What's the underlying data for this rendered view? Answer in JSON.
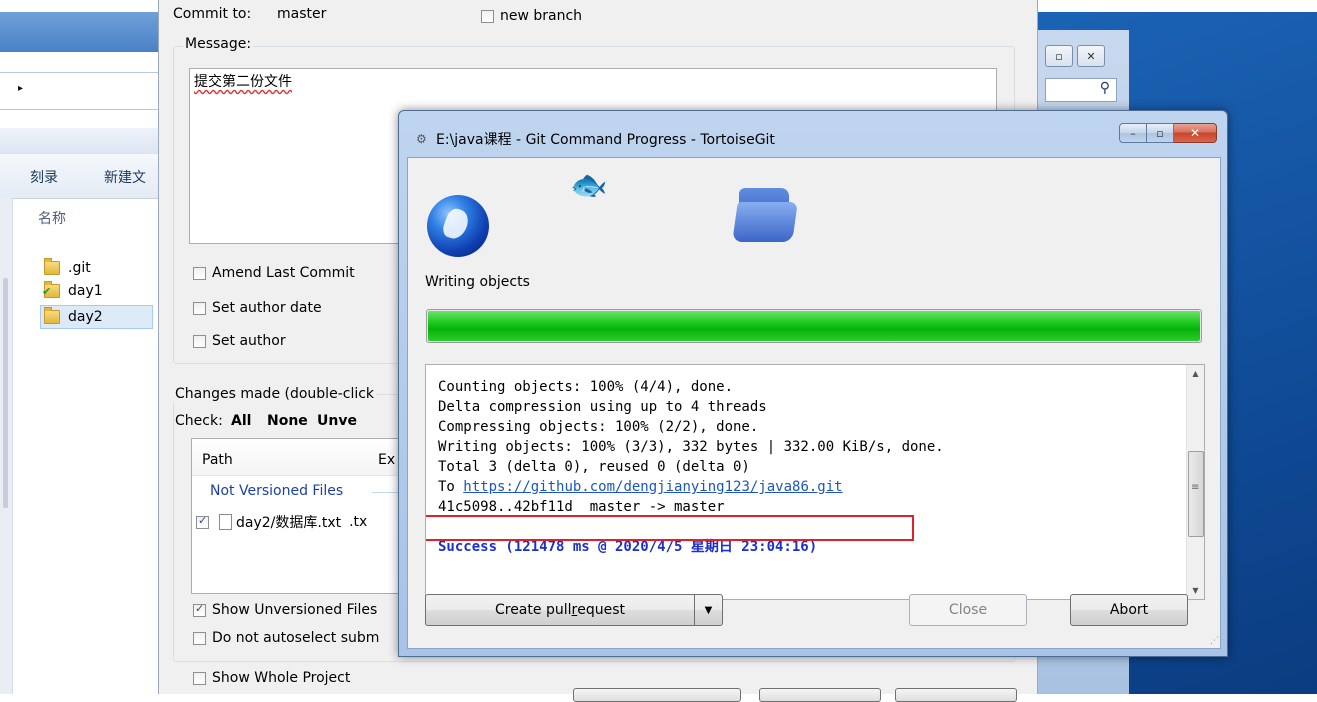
{
  "explorer": {
    "toolbar": [
      "刻录",
      "新建文"
    ],
    "column_name": "名称",
    "files": [
      ".git",
      "day1",
      "day2"
    ]
  },
  "background_window": {
    "restore_glyph": "▫",
    "close_glyph": "✕",
    "search_glyph": "⚲"
  },
  "commit": {
    "commit_to_label": "Commit to:",
    "branch": "master",
    "new_branch_label": "new branch",
    "message_label": "Message:",
    "message_text": "提交第二份文件",
    "amend_label": "Amend Last Commit",
    "set_author_date_label": "Set author date",
    "set_author_label": "Set author",
    "changes_label": "Changes made (double-click",
    "check_label": "Check:",
    "check_all": "All",
    "check_none": "None",
    "check_unversioned": "Unve",
    "list_headers": [
      "Path",
      "Ex"
    ],
    "group_not_versioned": "Not Versioned Files",
    "file_row": {
      "path": "day2/数据库.txt",
      "ext": ".tx",
      "checked": true
    },
    "show_unversioned_label": "Show Unversioned Files",
    "do_not_autoselect_label": "Do not autoselect subm",
    "show_whole_project_label": "Show Whole Project"
  },
  "progress": {
    "title": "E:\\java课程 - Git Command Progress - TortoiseGit",
    "status": "Writing objects",
    "progress_percent": 100,
    "progress_color": "#06b30a",
    "log_lines": [
      "Counting objects: 100% (4/4), done.",
      "Delta compression using up to 4 threads",
      "Compressing objects: 100% (2/2), done.",
      "Writing objects: 100% (3/3), 332 bytes | 332.00 KiB/s, done.",
      "Total 3 (delta 0), reused 0 (delta 0)"
    ],
    "to_prefix": "To ",
    "to_url": "https://github.com/dengjianying123/java86.git",
    "ref_line": "41c5098..42bf11d  master -> master",
    "success_line": "Success (121478 ms @ 2020/4/5 星期日 23:04:16)",
    "buttons": {
      "create_pr_prefix": "Create pull ",
      "create_pr_access": "r",
      "create_pr_suffix": "equest",
      "close": "Close",
      "abort": "Abort"
    },
    "window_buttons": {
      "minimize": "–",
      "maximize": "▫",
      "close": "✕"
    },
    "title_icon": "⚙",
    "fish_glyph": "🐟",
    "dropdown_glyph": "▼",
    "scroll_up_glyph": "▲",
    "scroll_down_glyph": "▼",
    "scroll_grip_glyph": "≡",
    "resize_grip_glyph": "⋰"
  },
  "explorer_nav_arrow": "▸"
}
